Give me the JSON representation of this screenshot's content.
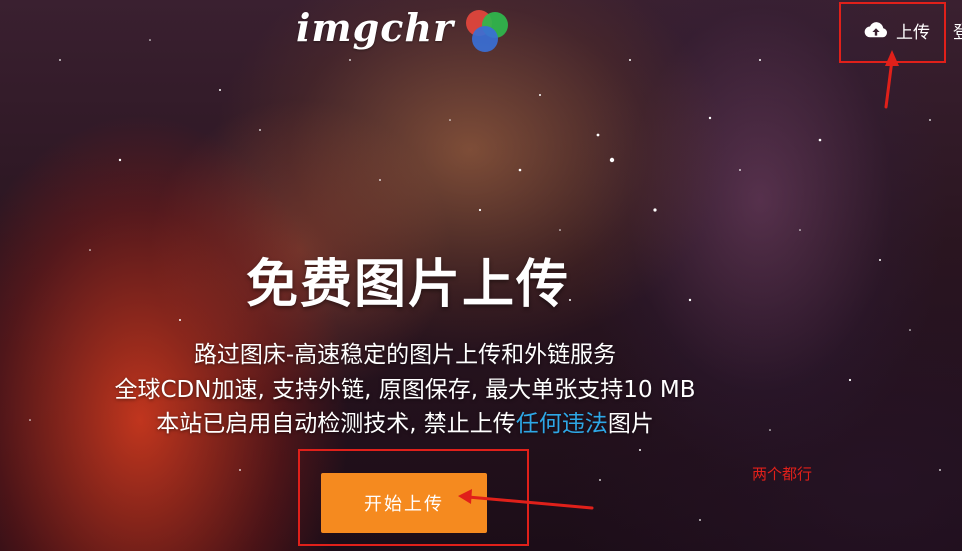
{
  "logo": {
    "text": "imgchr"
  },
  "nav": {
    "upload_label": "上传",
    "upload_icon": "cloud-upload-icon",
    "login_label": "登"
  },
  "hero": {
    "headline": "免费图片上传",
    "line1": "路过图床-高速稳定的图片上传和外链服务",
    "line2": "全球CDN加速, 支持外链, 原图保存, 最大单张支持10 MB",
    "line3_prefix": "本站已启用自动检测技术, 禁止上传",
    "line3_link": "任何违法",
    "line3_suffix": "图片"
  },
  "start_button": {
    "label": "开始上传"
  },
  "annotation": {
    "note": "两个都行",
    "color": "#e0201a"
  },
  "colors": {
    "button": "#f58a1f",
    "link": "#2ea7e6",
    "logo_red": "#e4473d",
    "logo_green": "#2fb94d",
    "logo_blue": "#3a6fd6"
  }
}
